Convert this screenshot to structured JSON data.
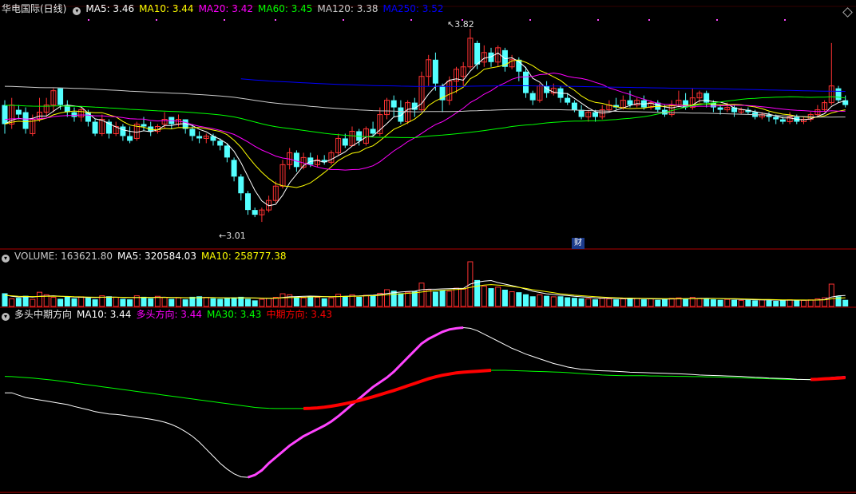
{
  "price_panel": {
    "stock_name": "华电国际(日线)",
    "indicators": [
      {
        "label": "MA5: 3.46",
        "color": "#ffffff"
      },
      {
        "label": "MA10: 3.44",
        "color": "#ffff00"
      },
      {
        "label": "MA20: 3.42",
        "color": "#ff00ff"
      },
      {
        "label": "MA60: 3.45",
        "color": "#00ff00"
      },
      {
        "label": "MA120: 3.38",
        "color": "#cccccc"
      },
      {
        "label": "MA250: 3.52",
        "color": "#0000ff"
      }
    ],
    "high_label": "3.82",
    "low_label": "3.01",
    "finance_badge": "财"
  },
  "volume_panel": {
    "indicators": [
      {
        "label": "VOLUME: 163621.80",
        "color": "#cccccc"
      },
      {
        "label": "MA5: 320584.03",
        "color": "#ffffff"
      },
      {
        "label": "MA10: 258777.38",
        "color": "#ffff00"
      }
    ]
  },
  "direction_panel": {
    "title": "多头中期方向",
    "indicators": [
      {
        "label": "MA10: 3.44",
        "color": "#ffffff"
      },
      {
        "label": "多头方向: 3.44",
        "color": "#ff00ff"
      },
      {
        "label": "MA30: 3.43",
        "color": "#00ff00"
      },
      {
        "label": "中期方向: 3.43",
        "color": "#ff0000"
      }
    ]
  },
  "colors": {
    "up": "#ff3232",
    "down": "#54ffff",
    "bg": "#000000",
    "separator": "#b00000",
    "ma5": "#ffffff",
    "ma10": "#ffff00",
    "ma20": "#ff00ff",
    "ma60": "#00ff00",
    "ma120": "#cccccc",
    "ma250": "#0000ff",
    "bull": "#ff44ff",
    "mid": "#ff0000"
  },
  "chart_data": {
    "type": "candlestick",
    "price_range": [
      2.93,
      3.88
    ],
    "candles": [
      [
        3.5,
        3.42,
        3.52,
        3.38
      ],
      [
        3.42,
        3.5,
        3.53,
        3.4
      ],
      [
        3.48,
        3.46,
        3.5,
        3.44
      ],
      [
        3.47,
        3.4,
        3.49,
        3.38
      ],
      [
        3.38,
        3.44,
        3.46,
        3.37
      ],
      [
        3.44,
        3.47,
        3.53,
        3.43
      ],
      [
        3.47,
        3.5,
        3.53,
        3.45
      ],
      [
        3.5,
        3.56,
        3.57,
        3.47
      ],
      [
        3.57,
        3.5,
        3.57,
        3.48
      ],
      [
        3.5,
        3.47,
        3.52,
        3.45
      ],
      [
        3.47,
        3.45,
        3.49,
        3.43
      ],
      [
        3.45,
        3.48,
        3.49,
        3.43
      ],
      [
        3.47,
        3.43,
        3.48,
        3.41
      ],
      [
        3.43,
        3.38,
        3.44,
        3.37
      ],
      [
        3.38,
        3.44,
        3.46,
        3.37
      ],
      [
        3.43,
        3.38,
        3.44,
        3.36
      ],
      [
        3.38,
        3.41,
        3.43,
        3.37
      ],
      [
        3.41,
        3.37,
        3.42,
        3.35
      ],
      [
        3.37,
        3.35,
        3.41,
        3.34
      ],
      [
        3.36,
        3.42,
        3.43,
        3.35
      ],
      [
        3.42,
        3.41,
        3.45,
        3.39
      ],
      [
        3.41,
        3.39,
        3.43,
        3.37
      ],
      [
        3.39,
        3.41,
        3.42,
        3.38
      ],
      [
        3.42,
        3.44,
        3.47,
        3.4
      ],
      [
        3.45,
        3.42,
        3.45,
        3.4
      ],
      [
        3.42,
        3.44,
        3.46,
        3.41
      ],
      [
        3.44,
        3.4,
        3.44,
        3.38
      ],
      [
        3.4,
        3.37,
        3.42,
        3.35
      ],
      [
        3.37,
        3.36,
        3.39,
        3.34
      ],
      [
        3.36,
        3.37,
        3.38,
        3.34
      ],
      [
        3.37,
        3.35,
        3.38,
        3.33
      ],
      [
        3.35,
        3.33,
        3.36,
        3.31
      ],
      [
        3.33,
        3.28,
        3.34,
        3.26
      ],
      [
        3.27,
        3.2,
        3.28,
        3.18
      ],
      [
        3.2,
        3.13,
        3.21,
        3.1
      ],
      [
        3.13,
        3.06,
        3.14,
        3.04
      ],
      [
        3.06,
        3.04,
        3.07,
        3.03
      ],
      [
        3.04,
        3.06,
        3.07,
        3.01
      ],
      [
        3.06,
        3.1,
        3.12,
        3.05
      ],
      [
        3.1,
        3.16,
        3.18,
        3.09
      ],
      [
        3.16,
        3.25,
        3.27,
        3.15
      ],
      [
        3.25,
        3.3,
        3.32,
        3.23
      ],
      [
        3.3,
        3.24,
        3.31,
        3.22
      ],
      [
        3.24,
        3.28,
        3.3,
        3.23
      ],
      [
        3.28,
        3.25,
        3.3,
        3.24
      ],
      [
        3.25,
        3.27,
        3.29,
        3.24
      ],
      [
        3.27,
        3.26,
        3.29,
        3.25
      ],
      [
        3.26,
        3.3,
        3.31,
        3.25
      ],
      [
        3.3,
        3.36,
        3.38,
        3.29
      ],
      [
        3.36,
        3.33,
        3.38,
        3.32
      ],
      [
        3.33,
        3.39,
        3.41,
        3.33
      ],
      [
        3.39,
        3.35,
        3.4,
        3.33
      ],
      [
        3.34,
        3.4,
        3.41,
        3.33
      ],
      [
        3.4,
        3.38,
        3.43,
        3.37
      ],
      [
        3.38,
        3.46,
        3.49,
        3.37
      ],
      [
        3.46,
        3.52,
        3.53,
        3.44
      ],
      [
        3.52,
        3.49,
        3.54,
        3.45
      ],
      [
        3.49,
        3.43,
        3.52,
        3.42
      ],
      [
        3.43,
        3.51,
        3.52,
        3.42
      ],
      [
        3.51,
        3.48,
        3.53,
        3.45
      ],
      [
        3.48,
        3.62,
        3.64,
        3.47
      ],
      [
        3.62,
        3.69,
        3.71,
        3.58
      ],
      [
        3.69,
        3.59,
        3.72,
        3.56
      ],
      [
        3.58,
        3.52,
        3.59,
        3.47
      ],
      [
        3.52,
        3.6,
        3.62,
        3.5
      ],
      [
        3.6,
        3.65,
        3.66,
        3.55
      ],
      [
        3.62,
        3.66,
        3.68,
        3.58
      ],
      [
        3.66,
        3.78,
        3.82,
        3.65
      ],
      [
        3.76,
        3.67,
        3.77,
        3.65
      ],
      [
        3.68,
        3.72,
        3.75,
        3.66
      ],
      [
        3.72,
        3.68,
        3.74,
        3.66
      ],
      [
        3.68,
        3.74,
        3.75,
        3.66
      ],
      [
        3.73,
        3.66,
        3.74,
        3.64
      ],
      [
        3.66,
        3.69,
        3.71,
        3.65
      ],
      [
        3.69,
        3.64,
        3.7,
        3.6
      ],
      [
        3.64,
        3.55,
        3.66,
        3.53
      ],
      [
        3.55,
        3.52,
        3.56,
        3.5
      ],
      [
        3.52,
        3.58,
        3.59,
        3.51
      ],
      [
        3.58,
        3.55,
        3.6,
        3.53
      ],
      [
        3.55,
        3.57,
        3.59,
        3.54
      ],
      [
        3.57,
        3.53,
        3.58,
        3.51
      ],
      [
        3.53,
        3.51,
        3.55,
        3.5
      ],
      [
        3.51,
        3.48,
        3.52,
        3.47
      ],
      [
        3.48,
        3.45,
        3.5,
        3.44
      ],
      [
        3.45,
        3.47,
        3.48,
        3.43
      ],
      [
        3.47,
        3.45,
        3.48,
        3.43
      ],
      [
        3.45,
        3.48,
        3.5,
        3.44
      ],
      [
        3.48,
        3.5,
        3.52,
        3.47
      ],
      [
        3.5,
        3.49,
        3.53,
        3.48
      ],
      [
        3.49,
        3.52,
        3.54,
        3.48
      ],
      [
        3.52,
        3.5,
        3.56,
        3.49
      ],
      [
        3.5,
        3.52,
        3.53,
        3.49
      ],
      [
        3.52,
        3.49,
        3.54,
        3.48
      ],
      [
        3.49,
        3.51,
        3.52,
        3.48
      ],
      [
        3.51,
        3.48,
        3.52,
        3.47
      ],
      [
        3.48,
        3.46,
        3.5,
        3.45
      ],
      [
        3.46,
        3.5,
        3.52,
        3.45
      ],
      [
        3.5,
        3.52,
        3.56,
        3.49
      ],
      [
        3.52,
        3.49,
        3.55,
        3.48
      ],
      [
        3.49,
        3.53,
        3.57,
        3.48
      ],
      [
        3.53,
        3.55,
        3.56,
        3.51
      ],
      [
        3.55,
        3.51,
        3.56,
        3.49
      ],
      [
        3.51,
        3.49,
        3.52,
        3.47
      ],
      [
        3.49,
        3.48,
        3.5,
        3.46
      ],
      [
        3.48,
        3.49,
        3.51,
        3.47
      ],
      [
        3.49,
        3.47,
        3.5,
        3.45
      ],
      [
        3.47,
        3.48,
        3.49,
        3.46
      ],
      [
        3.48,
        3.47,
        3.49,
        3.46
      ],
      [
        3.47,
        3.45,
        3.48,
        3.44
      ],
      [
        3.45,
        3.46,
        3.47,
        3.44
      ],
      [
        3.46,
        3.45,
        3.47,
        3.43
      ],
      [
        3.45,
        3.44,
        3.46,
        3.42
      ],
      [
        3.44,
        3.43,
        3.45,
        3.42
      ],
      [
        3.43,
        3.45,
        3.47,
        3.42
      ],
      [
        3.45,
        3.43,
        3.46,
        3.42
      ],
      [
        3.43,
        3.44,
        3.45,
        3.42
      ],
      [
        3.44,
        3.46,
        3.47,
        3.43
      ],
      [
        3.46,
        3.48,
        3.5,
        3.45
      ],
      [
        3.48,
        3.51,
        3.52,
        3.47
      ],
      [
        3.51,
        3.58,
        3.76,
        3.5
      ],
      [
        3.57,
        3.52,
        3.58,
        3.51
      ],
      [
        3.52,
        3.5,
        3.54,
        3.49
      ]
    ],
    "volume_range": [
      0,
      880000
    ],
    "volumes": [
      260000,
      150000,
      170000,
      210000,
      140000,
      280000,
      230000,
      180000,
      150000,
      200000,
      160000,
      190000,
      170000,
      140000,
      210000,
      200000,
      180000,
      150000,
      140000,
      210000,
      190000,
      160000,
      200000,
      180000,
      150000,
      170000,
      140000,
      190000,
      200000,
      180000,
      160000,
      150000,
      170000,
      180000,
      190000,
      150000,
      120000,
      140000,
      160000,
      180000,
      250000,
      230000,
      190000,
      170000,
      200000,
      180000,
      160000,
      170000,
      240000,
      200000,
      230000,
      190000,
      220000,
      210000,
      260000,
      330000,
      310000,
      260000,
      280000,
      300000,
      460000,
      330000,
      290000,
      320000,
      300000,
      360000,
      340000,
      880000,
      520000,
      400000,
      360000,
      380000,
      330000,
      290000,
      280000,
      240000,
      200000,
      230000,
      210000,
      190000,
      200000,
      180000,
      170000,
      160000,
      150000,
      140000,
      160000,
      150000,
      140000,
      150000,
      170000,
      160000,
      140000,
      150000,
      130000,
      140000,
      160000,
      170000,
      150000,
      180000,
      160000,
      150000,
      140000,
      130000,
      140000,
      130000,
      120000,
      130000,
      120000,
      130000,
      120000,
      110000,
      120000,
      130000,
      120000,
      120000,
      130000,
      150000,
      170000,
      440000,
      200000,
      130000
    ],
    "vol_ma5": [
      230000,
      200000,
      185000,
      195000,
      185000,
      200000,
      205000,
      210000,
      200000,
      195000,
      185000,
      180000,
      178000,
      175000,
      180000,
      185000,
      182000,
      178000,
      175000,
      178000,
      180000,
      178000,
      180000,
      182000,
      178000,
      175000,
      170000,
      172000,
      175000,
      178000,
      175000,
      172000,
      168000,
      170000,
      172000,
      170000,
      165000,
      160000,
      158000,
      162000,
      178000,
      190000,
      195000,
      200000,
      205000,
      200000,
      195000,
      190000,
      195000,
      200000,
      205000,
      208000,
      215000,
      222000,
      235000,
      255000,
      270000,
      285000,
      295000,
      300000,
      330000,
      340000,
      340000,
      345000,
      350000,
      355000,
      355000,
      440000,
      480000,
      500000,
      510000,
      470000,
      440000,
      410000,
      380000,
      340000,
      300000,
      275000,
      250000,
      235000,
      225000,
      215000,
      200000,
      190000,
      180000,
      170000,
      165000,
      160000,
      158000,
      155000,
      155000,
      155000,
      152000,
      150000,
      148000,
      146000,
      148000,
      150000,
      152000,
      155000,
      158000,
      160000,
      158000,
      155000,
      150000,
      145000,
      140000,
      136000,
      132000,
      130000,
      128000,
      126000,
      124000,
      124000,
      124000,
      124000,
      124000,
      128000,
      135000,
      185000,
      210000,
      215000
    ],
    "vol_ma10": [
      220000,
      210000,
      200000,
      198000,
      195000,
      197000,
      200000,
      202000,
      200000,
      198000,
      192000,
      188000,
      185000,
      182000,
      182000,
      183000,
      182000,
      180000,
      178000,
      178000,
      179000,
      178000,
      178000,
      179000,
      178000,
      176000,
      173000,
      172000,
      173000,
      175000,
      174000,
      172000,
      170000,
      170000,
      170000,
      170000,
      168000,
      165000,
      163000,
      164000,
      170000,
      175000,
      178000,
      183000,
      188000,
      190000,
      192000,
      192000,
      195000,
      198000,
      200000,
      203000,
      207000,
      212000,
      220000,
      230000,
      240000,
      250000,
      260000,
      268000,
      285000,
      300000,
      310000,
      318000,
      325000,
      335000,
      345000,
      375000,
      400000,
      420000,
      430000,
      420000,
      410000,
      395000,
      375000,
      355000,
      330000,
      310000,
      290000,
      270000,
      250000,
      235000,
      222000,
      212000,
      202000,
      194000,
      186000,
      178000,
      172000,
      167000,
      165000,
      162000,
      159000,
      157000,
      155000,
      153000,
      152000,
      152000,
      152000,
      153000,
      154000,
      155000,
      155000,
      155000,
      154000,
      152000,
      149000,
      146000,
      142000,
      139000,
      136000,
      133000,
      131000,
      129000,
      128000,
      127000,
      126000,
      127000,
      130000,
      150000,
      165000,
      172000
    ],
    "ma10_line": [
      3.38,
      3.38,
      3.37,
      3.36,
      3.355,
      3.35,
      3.345,
      3.34,
      3.335,
      3.33,
      3.322,
      3.315,
      3.308,
      3.3,
      3.295,
      3.29,
      3.288,
      3.285,
      3.28,
      3.276,
      3.272,
      3.268,
      3.262,
      3.255,
      3.245,
      3.232,
      3.215,
      3.195,
      3.17,
      3.14,
      3.11,
      3.08,
      3.055,
      3.035,
      3.022,
      3.02,
      3.03,
      3.05,
      3.08,
      3.105,
      3.13,
      3.155,
      3.175,
      3.195,
      3.21,
      3.225,
      3.24,
      3.258,
      3.28,
      3.305,
      3.33,
      3.355,
      3.38,
      3.405,
      3.425,
      3.445,
      3.47,
      3.5,
      3.53,
      3.56,
      3.59,
      3.61,
      3.625,
      3.64,
      3.65,
      3.655,
      3.658,
      3.655,
      3.645,
      3.63,
      3.615,
      3.6,
      3.585,
      3.57,
      3.558,
      3.545,
      3.535,
      3.525,
      3.515,
      3.505,
      3.498,
      3.49,
      3.485,
      3.48,
      3.478,
      3.475,
      3.474,
      3.473,
      3.472,
      3.47,
      3.468,
      3.467,
      3.466,
      3.465,
      3.464,
      3.463,
      3.462,
      3.461,
      3.46,
      3.458,
      3.456,
      3.455,
      3.454,
      3.453,
      3.452,
      3.451,
      3.45,
      3.448,
      3.446,
      3.445,
      3.443,
      3.442,
      3.441,
      3.44,
      3.438,
      3.437,
      3.436,
      3.437,
      3.44,
      3.443,
      3.445,
      3.447
    ],
    "ma30_line": [
      3.45,
      3.449,
      3.447,
      3.445,
      3.443,
      3.44,
      3.437,
      3.434,
      3.43,
      3.426,
      3.422,
      3.418,
      3.414,
      3.41,
      3.406,
      3.402,
      3.398,
      3.394,
      3.39,
      3.386,
      3.382,
      3.378,
      3.374,
      3.37,
      3.366,
      3.362,
      3.358,
      3.354,
      3.35,
      3.346,
      3.342,
      3.338,
      3.334,
      3.33,
      3.326,
      3.322,
      3.318,
      3.316,
      3.314,
      3.313,
      3.313,
      3.313,
      3.313,
      3.313,
      3.314,
      3.316,
      3.319,
      3.323,
      3.328,
      3.334,
      3.34,
      3.347,
      3.355,
      3.363,
      3.372,
      3.381,
      3.39,
      3.4,
      3.41,
      3.42,
      3.43,
      3.44,
      3.448,
      3.455,
      3.46,
      3.465,
      3.468,
      3.47,
      3.472,
      3.474,
      3.476,
      3.476,
      3.476,
      3.475,
      3.474,
      3.473,
      3.472,
      3.471,
      3.47,
      3.469,
      3.468,
      3.466,
      3.464,
      3.462,
      3.46,
      3.458,
      3.456,
      3.455,
      3.454,
      3.453,
      3.453,
      3.453,
      3.453,
      3.452,
      3.452,
      3.451,
      3.451,
      3.45,
      3.45,
      3.449,
      3.449,
      3.448,
      3.448,
      3.447,
      3.446,
      3.445,
      3.444,
      3.443,
      3.442,
      3.441,
      3.44,
      3.439,
      3.438,
      3.437,
      3.437,
      3.437,
      3.437,
      3.438,
      3.44,
      3.441,
      3.443,
      3.445
    ]
  }
}
